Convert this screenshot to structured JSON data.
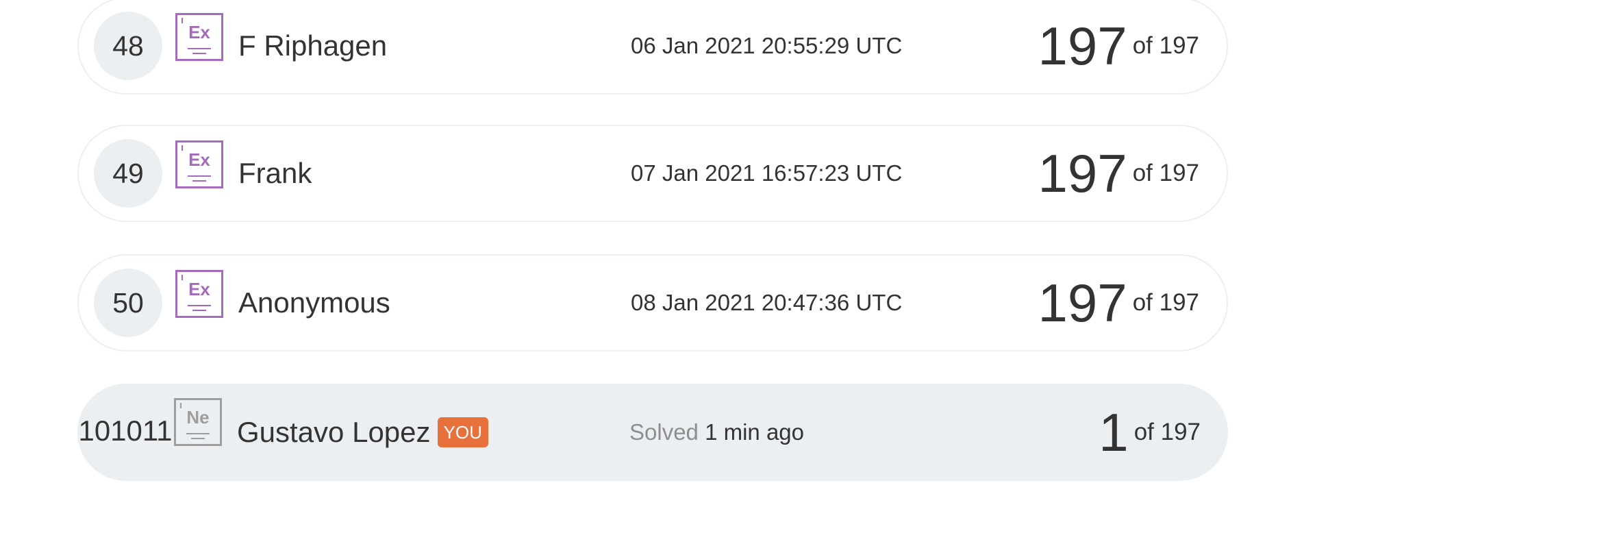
{
  "leaderboard": {
    "rows": [
      {
        "rank": "48",
        "badge": "Ex",
        "name": "F Riphagen",
        "time": "06 Jan 2021 20:55:29 UTC",
        "score": "197",
        "of_total": "of 197"
      },
      {
        "rank": "49",
        "badge": "Ex",
        "name": "Frank",
        "time": "07 Jan 2021 16:57:23 UTC",
        "score": "197",
        "of_total": "of 197"
      },
      {
        "rank": "50",
        "badge": "Ex",
        "name": "Anonymous",
        "time": "08 Jan 2021 20:47:36 UTC",
        "score": "197",
        "of_total": "of 197"
      }
    ],
    "current_user": {
      "rank": "101011",
      "badge": "Ne",
      "name": "Gustavo Lopez",
      "you_tag": "YOU",
      "solved_prefix": "Solved",
      "time": "1 min ago",
      "score": "1",
      "of_total": "of 197"
    }
  },
  "colors": {
    "expert_badge": "#a569bd",
    "newbie_badge": "#9e9e9e",
    "you_tag": "#e8703a",
    "row_border": "#eceff1",
    "highlight_row": "#eceff1"
  },
  "icons": {
    "expert": "expert-badge-icon",
    "newbie": "newbie-badge-icon"
  }
}
